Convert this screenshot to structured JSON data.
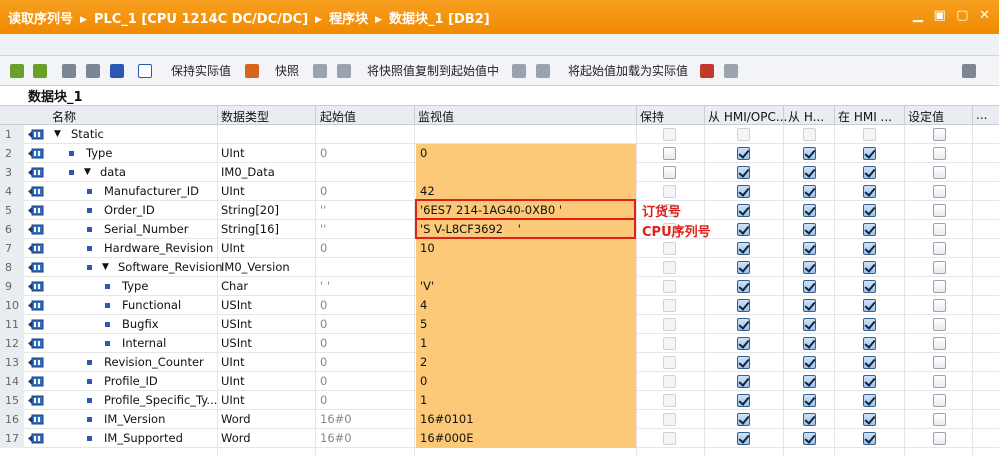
{
  "window": {
    "breadcrumb": [
      "读取序列号",
      "PLC_1 [CPU 1214C DC/DC/DC]",
      "程序块",
      "数据块_1 [DB2]"
    ],
    "controls": "▁ ▣ ▢ ✕"
  },
  "toolbar": {
    "keep_actual": "保持实际值",
    "snapshot": "快照",
    "copy_snapshot": "将快照值复制到起始值中",
    "load_start": "将起始值加载为实际值"
  },
  "block_title": "数据块_1",
  "columns": {
    "name": "名称",
    "datatype": "数据类型",
    "start": "起始值",
    "monitor": "监视值",
    "retain": "保持",
    "hmi_opc": "从 HMI/OPC...",
    "hmi_h": "从 H...",
    "hmi_in": "在 HMI ...",
    "setpoint": "设定值",
    "more": "..."
  },
  "rows": [
    {
      "n": "1",
      "name": "Static",
      "type": "",
      "start": "",
      "mon": "",
      "level": 0,
      "tri": "▼",
      "bullet": false
    },
    {
      "n": "2",
      "name": "Type",
      "type": "UInt",
      "start": "0",
      "mon": "0",
      "level": 1,
      "tri": "",
      "bullet": true
    },
    {
      "n": "3",
      "name": "data",
      "type": "IM0_Data",
      "start": "",
      "mon": "",
      "level": 1,
      "tri": "▼",
      "bullet": true
    },
    {
      "n": "4",
      "name": "Manufacturer_ID",
      "type": "UInt",
      "start": "0",
      "mon": "42",
      "level": 2,
      "tri": "",
      "bullet": true
    },
    {
      "n": "5",
      "name": "Order_ID",
      "type": "String[20]",
      "start": "''",
      "mon": "'6ES7 214-1AG40-0XB0 '",
      "level": 2,
      "tri": "",
      "bullet": true
    },
    {
      "n": "6",
      "name": "Serial_Number",
      "type": "String[16]",
      "start": "''",
      "mon": "'S V-L8CF3692    '",
      "level": 2,
      "tri": "",
      "bullet": true
    },
    {
      "n": "7",
      "name": "Hardware_Revision",
      "type": "UInt",
      "start": "0",
      "mon": "10",
      "level": 2,
      "tri": "",
      "bullet": true
    },
    {
      "n": "8",
      "name": "Software_Revision",
      "type": "IM0_Version",
      "start": "",
      "mon": "",
      "level": 2,
      "tri": "▼",
      "bullet": true
    },
    {
      "n": "9",
      "name": "Type",
      "type": "Char",
      "start": "' '",
      "mon": "'V'",
      "level": 3,
      "tri": "",
      "bullet": true
    },
    {
      "n": "10",
      "name": "Functional",
      "type": "USInt",
      "start": "0",
      "mon": "4",
      "level": 3,
      "tri": "",
      "bullet": true
    },
    {
      "n": "11",
      "name": "Bugfix",
      "type": "USInt",
      "start": "0",
      "mon": "5",
      "level": 3,
      "tri": "",
      "bullet": true
    },
    {
      "n": "12",
      "name": "Internal",
      "type": "USInt",
      "start": "0",
      "mon": "1",
      "level": 3,
      "tri": "",
      "bullet": true
    },
    {
      "n": "13",
      "name": "Revision_Counter",
      "type": "UInt",
      "start": "0",
      "mon": "2",
      "level": 2,
      "tri": "",
      "bullet": true
    },
    {
      "n": "14",
      "name": "Profile_ID",
      "type": "UInt",
      "start": "0",
      "mon": "0",
      "level": 2,
      "tri": "",
      "bullet": true
    },
    {
      "n": "15",
      "name": "Profile_Specific_Ty...",
      "type": "UInt",
      "start": "0",
      "mon": "1",
      "level": 2,
      "tri": "",
      "bullet": true
    },
    {
      "n": "16",
      "name": "IM_Version",
      "type": "Word",
      "start": "16#0",
      "mon": "16#0101",
      "level": 2,
      "tri": "",
      "bullet": true
    },
    {
      "n": "17",
      "name": "IM_Supported",
      "type": "Word",
      "start": "16#0",
      "mon": "16#000E",
      "level": 2,
      "tri": "",
      "bullet": true
    }
  ],
  "checkbox_states": [
    [
      "dis",
      "dis",
      "dis",
      "dis",
      "off"
    ],
    [
      "off",
      "on",
      "on",
      "on",
      "off"
    ],
    [
      "off",
      "on",
      "on",
      "on",
      "off"
    ],
    [
      "dis",
      "on",
      "on",
      "on",
      "off"
    ],
    [
      "dis",
      "on",
      "on",
      "on",
      "off"
    ],
    [
      "dis",
      "on",
      "on",
      "on",
      "off"
    ],
    [
      "dis",
      "on",
      "on",
      "on",
      "off"
    ],
    [
      "dis",
      "on",
      "on",
      "on",
      "off"
    ],
    [
      "dis",
      "on",
      "on",
      "on",
      "off"
    ],
    [
      "dis",
      "on",
      "on",
      "on",
      "off"
    ],
    [
      "dis",
      "on",
      "on",
      "on",
      "off"
    ],
    [
      "dis",
      "on",
      "on",
      "on",
      "off"
    ],
    [
      "dis",
      "on",
      "on",
      "on",
      "off"
    ],
    [
      "dis",
      "on",
      "on",
      "on",
      "off"
    ],
    [
      "dis",
      "on",
      "on",
      "on",
      "off"
    ],
    [
      "dis",
      "on",
      "on",
      "on",
      "off"
    ],
    [
      "dis",
      "on",
      "on",
      "on",
      "off"
    ]
  ],
  "annotations": {
    "order_label": "订货号",
    "cpu_serial_label": "CPU序列号"
  },
  "colors": {
    "title_bg": "#f39200",
    "monitor_bg": "#fcc978",
    "highlight": "#e0201a"
  }
}
